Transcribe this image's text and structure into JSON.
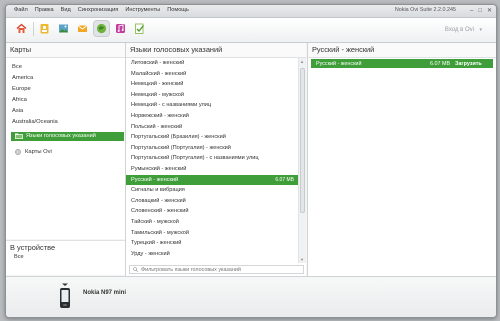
{
  "menu": {
    "items": [
      "Файл",
      "Правка",
      "Вид",
      "Синхронизация",
      "Инструменты",
      "Помощь"
    ],
    "app_title": "Nokia Ovi Suite 2.2.0.245"
  },
  "toolbar": {
    "login_label": "Вход в Ovi",
    "icons": [
      "home-icon",
      "contacts-icon",
      "gallery-icon",
      "messages-icon",
      "maps-icon",
      "music-icon",
      "sync-icon"
    ]
  },
  "left": {
    "header": "Карты",
    "regions": [
      "Все",
      "America",
      "Europe",
      "Africa",
      "Asia",
      "Australia/Oceania"
    ],
    "selected_item": "Языки голосовых указаний",
    "ovi_maps": "Карты Ovi",
    "device_header": "В устройстве",
    "device_value": "Все"
  },
  "middle": {
    "header": "Языки голосовых указаний",
    "items": [
      {
        "label": "Литовский - женский",
        "size": ""
      },
      {
        "label": "Малайский - женский",
        "size": ""
      },
      {
        "label": "Немецкий - женский",
        "size": ""
      },
      {
        "label": "Немецкий - мужской",
        "size": ""
      },
      {
        "label": "Немецкий - с названиями улиц",
        "size": ""
      },
      {
        "label": "Норвежский - женский",
        "size": ""
      },
      {
        "label": "Польский - женский",
        "size": ""
      },
      {
        "label": "Португальский (Бразилия) - женский",
        "size": ""
      },
      {
        "label": "Португальский (Португалия) - женский",
        "size": ""
      },
      {
        "label": "Португальский (Португалия) - с названиями улиц",
        "size": ""
      },
      {
        "label": "Румынский - женский",
        "size": ""
      },
      {
        "label": "Русский - женский",
        "size": "6.07 MB",
        "selected": true
      },
      {
        "label": "Сигналы и вибрация",
        "size": ""
      },
      {
        "label": "Словацкий - женский",
        "size": ""
      },
      {
        "label": "Словенский - женский",
        "size": ""
      },
      {
        "label": "Тайский - мужской",
        "size": ""
      },
      {
        "label": "Тамильский - мужской",
        "size": ""
      },
      {
        "label": "Турецкий - женский",
        "size": ""
      },
      {
        "label": "Урду - женский",
        "size": ""
      }
    ],
    "filter_placeholder": "Фильтровать языки голосовых указаний"
  },
  "right": {
    "header": "Русский - женский",
    "row_label": "Русский - женский",
    "row_size": "6.07 MB",
    "download_label": "Загрузить"
  },
  "device": {
    "name": "Nokia N97 mini"
  },
  "colors": {
    "accent_green": "#3f9e39",
    "window_bg": "#f4f5f5",
    "desktop_bg": "#b9bcbf"
  }
}
